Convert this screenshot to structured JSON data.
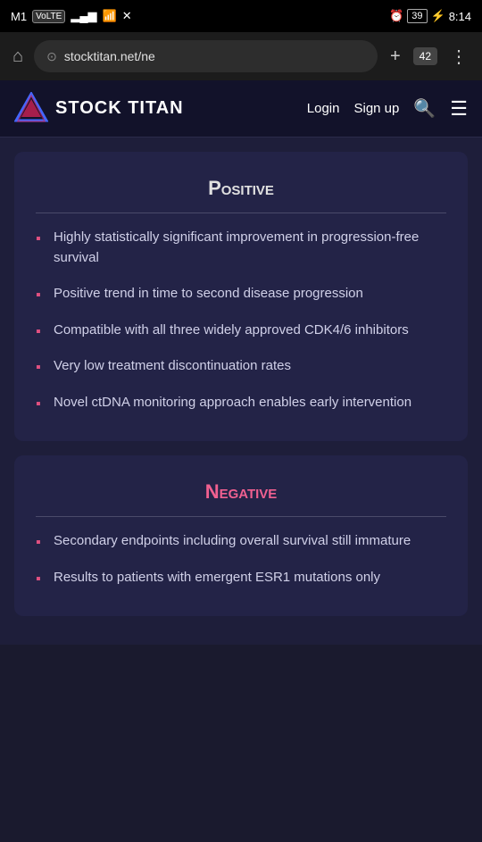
{
  "status_bar": {
    "carrier": "M1",
    "carrier_type": "VoLTE",
    "signal_bars": "▂▄▆",
    "wifi": "WiFi",
    "battery_percent": "39",
    "charging": true,
    "time": "8:14"
  },
  "browser": {
    "home_icon": "⌂",
    "address": "stocktitan.net/ne",
    "new_tab_icon": "+",
    "tab_count": "42",
    "menu_icon": "⋮"
  },
  "navbar": {
    "logo_text": "STOCK TITAN",
    "login_label": "Login",
    "signup_label": "Sign up",
    "search_icon": "search",
    "menu_icon": "menu"
  },
  "positive_card": {
    "title": "Positive",
    "items": [
      "Highly statistically significant improvement in progression-free survival",
      "Positive trend in time to second disease progression",
      "Compatible with all three widely approved CDK4/6 inhibitors",
      "Very low treatment discontinuation rates",
      "Novel ctDNA monitoring approach enables early intervention"
    ]
  },
  "negative_card": {
    "title": "Negative",
    "items": [
      "Secondary endpoints including overall survival still immature",
      "Results to patients with emergent ESR1 mutations only"
    ]
  }
}
